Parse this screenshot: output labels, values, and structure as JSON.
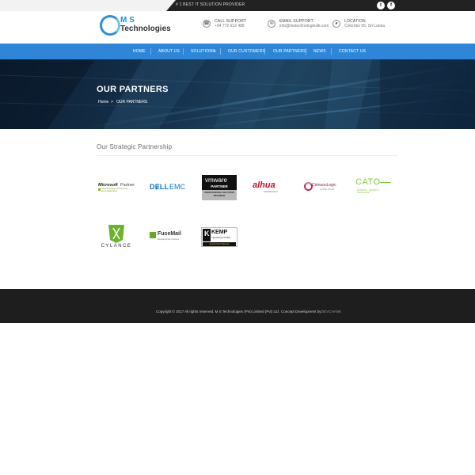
{
  "topbar": {
    "tagline": "# 1 BEST IT SOLUTION PROVIDER",
    "twitter_glyph": "t",
    "facebook_glyph": "f"
  },
  "logo": {
    "ms": "M S",
    "tech": "Technologies"
  },
  "header": {
    "call_title": "CALL SUPPORT",
    "call_value": "+94 772 612 488",
    "email_title": "EMAIL SUPPORT",
    "email_value": "info@mstechnologieslk.com",
    "loc_title": "LOCATION",
    "loc_value": "Colombo 05, Sri Lanka."
  },
  "nav": [
    "HOME",
    "ABOUT US",
    "SOLUTIONS",
    "OUR CUSTOMERS",
    "OUR PARTNERS",
    "NEWS",
    "CONTACT US"
  ],
  "banner": {
    "title": "OUR PARTNERS",
    "crumb_home": "Home",
    "crumb_sep": ">",
    "crumb_current": "OUR PARTNERS"
  },
  "section": {
    "title": "Our Strategic Partnership"
  },
  "partners": {
    "microsoft": {
      "name": "Microsoft",
      "tag": "Partner",
      "sub": "Communications Productivity and Collaboration"
    },
    "dellemc": {
      "dell": "DɆLL",
      "emc": "EMC"
    },
    "vmware": {
      "name": "vmware",
      "tag": "PARTNER",
      "sub": "PROFESSIONAL SOLUTION PROVIDER"
    },
    "dahua": {
      "name": "alhua",
      "sub": "TECHNOLOGY"
    },
    "crimsonlogic": {
      "name": "CrimsonLogic",
      "sub": "GLOBAL TRADE"
    },
    "cato": {
      "name": "CATO",
      "sub": "NETWORK + SECURITY = SIMPLE NOW"
    },
    "cylance": {
      "name": "CYLANCE"
    },
    "fusemail": {
      "name": "FuseMail",
      "sub": "Managed Email Solutions"
    },
    "kemp": {
      "name": "KEMP",
      "sub": "TECHNOLOGIES",
      "tag": "Authorized Partner"
    }
  },
  "footer": {
    "copyright": "Copyright © 2017 All rights reserved. M S Technologies (Pvt) Limited (Pvt) Ltd.",
    "concept": "Concept Development by",
    "brand": "DEVCHANK"
  },
  "colors": {
    "nav": "#2f86d9",
    "footer": "#1e1e1e",
    "accent": "#2a8fd8"
  }
}
